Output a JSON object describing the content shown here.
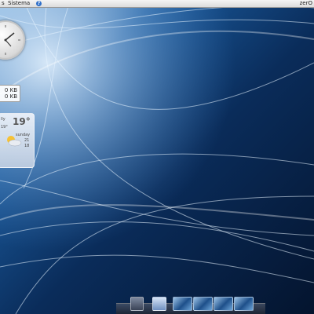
{
  "top_panel": {
    "left_menu_label": "s",
    "system_menu_label": "Sistema",
    "user_name": "zerO",
    "help_icon": "help-icon"
  },
  "widgets": {
    "network": {
      "upload": "0 KB",
      "download": "0 KB"
    },
    "weather": {
      "city": "lly",
      "temperature": "19°",
      "low": "19°",
      "day": "sunday",
      "values": [
        "21",
        "18"
      ],
      "icon": "partly-cloudy-icon"
    },
    "clock": {
      "icon": "clock-icon"
    }
  },
  "dock": {
    "items": [
      "terminal-icon",
      "mail-icon",
      "window-preview",
      "window-preview",
      "window-preview",
      "window-preview"
    ]
  },
  "colors": {
    "wallpaper_dark": "#061a3a",
    "wallpaper_mid": "#0d4a8a",
    "panel": "#e8e8e8"
  }
}
